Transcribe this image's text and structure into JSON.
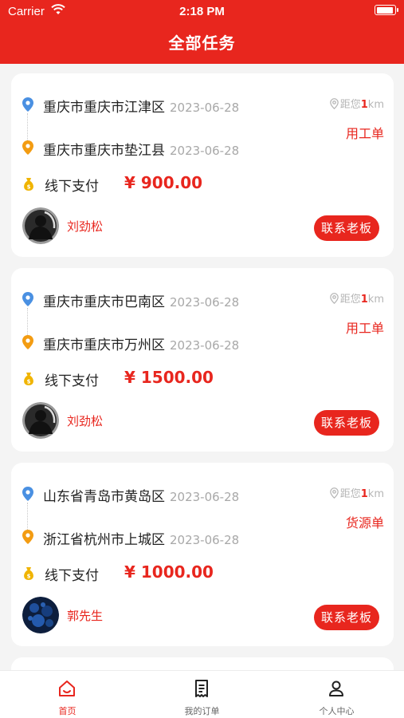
{
  "status_bar": {
    "carrier": "Carrier",
    "time": "2:18 PM"
  },
  "header": {
    "title": "全部任务"
  },
  "tasks": [
    {
      "from": "重庆市重庆市江津区",
      "from_date": "2023-06-28",
      "to": "重庆市重庆市垫江县",
      "to_date": "2023-06-28",
      "distance_prefix": "距您",
      "distance_num": "1",
      "distance_unit": "km",
      "type": "用工单",
      "payment": "线下支付",
      "price": "¥ 900.00",
      "boss": "刘劲松",
      "avatar": "dark",
      "button": "联系老板"
    },
    {
      "from": "重庆市重庆市巴南区",
      "from_date": "2023-06-28",
      "to": "重庆市重庆市万州区",
      "to_date": "2023-06-28",
      "distance_prefix": "距您",
      "distance_num": "1",
      "distance_unit": "km",
      "type": "用工单",
      "payment": "线下支付",
      "price": "¥ 1500.00",
      "boss": "刘劲松",
      "avatar": "dark",
      "button": "联系老板"
    },
    {
      "from": "山东省青岛市黄岛区",
      "from_date": "2023-06-28",
      "to": "浙江省杭州市上城区",
      "to_date": "2023-06-28",
      "distance_prefix": "距您",
      "distance_num": "1",
      "distance_unit": "km",
      "type": "货源单",
      "payment": "线下支付",
      "price": "¥ 1000.00",
      "boss": "郭先生",
      "avatar": "blue",
      "button": "联系老板"
    }
  ],
  "tabbar": {
    "items": [
      {
        "label": "首页",
        "icon": "home-icon",
        "active": true
      },
      {
        "label": "我的订单",
        "icon": "order-icon",
        "active": false
      },
      {
        "label": "个人中心",
        "icon": "user-icon",
        "active": false
      }
    ]
  },
  "colors": {
    "brand": "#e8261e",
    "from_pin": "#4a90e2",
    "to_pin": "#f39c12",
    "money": "#f0b400"
  }
}
